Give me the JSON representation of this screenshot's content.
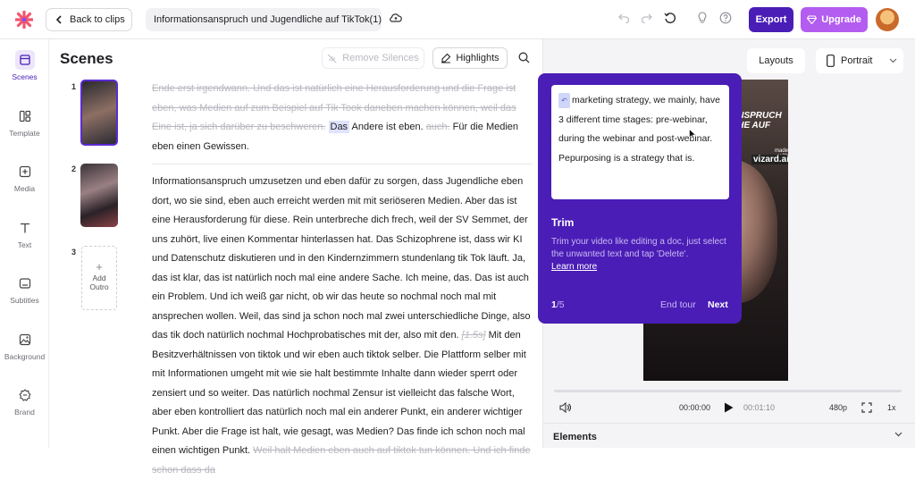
{
  "topbar": {
    "back_label": "Back to clips",
    "project_title": "Informationsanspruch und Jugendliche auf TikTok(1)",
    "export_label": "Export",
    "upgrade_label": "Upgrade"
  },
  "sidebar": {
    "items": [
      {
        "label": "Scenes",
        "icon": "scenes-icon",
        "active": true
      },
      {
        "label": "Template",
        "icon": "template-icon"
      },
      {
        "label": "Media",
        "icon": "media-icon"
      },
      {
        "label": "Text",
        "icon": "text-icon"
      },
      {
        "label": "Subtitles",
        "icon": "subtitles-icon"
      },
      {
        "label": "Background",
        "icon": "background-icon"
      },
      {
        "label": "Brand",
        "icon": "brand-icon"
      }
    ]
  },
  "scenes": {
    "title": "Scenes",
    "remove_silences_label": "Remove Silences",
    "highlights_label": "Highlights",
    "numbers": [
      "1",
      "2",
      "3"
    ],
    "add_outro_label": "Add Outro"
  },
  "transcript": {
    "seg1_struck": "Ende erst irgendwann. Und das ist natürlich eine Herausforderung und die Frage ist eben, was Medien auf zum Beispiel auf Tik Took daneben machen können, weil das Eine ist, ja sich darüber zu beschweren.",
    "seg1_hl": "Das",
    "seg1_mid": " Andere ist eben. ",
    "seg1_faded": "auch.",
    "seg1_end": " Für die Medien eben einen Gewissen.",
    "seg2_a": "Informationsanspruch umzusetzen und eben dafür zu sorgen, dass Jugendliche eben dort, wo sie sind, eben auch erreicht werden mit mit seriöseren Medien. Aber das ist eine Herausforderung für diese. Rein unterbreche dich frech, weil der SV Semmet, der uns zuhört, live einen Kommentar hinterlassen hat. Das Schizophrene ist, dass wir KI und Datenschutz diskutieren und in den Kindernzimmern stundenlang tik Tok läuft. Ja, das ist klar, das ist natürlich noch mal eine andere Sache. Ich meine, das. Das ist auch ein Problem. Und ich weiß gar nicht, ob wir das heute so nochmal noch mal mit ansprechen wollen. Weil, das sind ja schon noch mal zwei unterschiedliche Dinge, also das tik doch natürlich nochmal Hochprobatisches mit der, also mit den. ",
    "pause": "[1.5s]",
    "seg2_b": " Mit den Besitzverhältnissen von tiktok und wir eben auch tiktok selber. Die Plattform selber mit mit Informationen umgeht mit wie sie halt bestimmte Inhalte dann wieder sperrt oder zensiert und so weiter. Das natürlich nochmal Zensur ist vielleicht das falsche Wort, aber eben kontrolliert das natürlich noch mal ein anderer Punkt, ein anderer wichtiger Punkt. Aber die Frage ist halt, wie gesagt, was Medien? Das finde ich schon noch mal einen wichtigen Punkt. ",
    "seg2_faded": "Weil halt Medien eben auch auf tiktok tun können. Und ich finde schon dass da"
  },
  "preview": {
    "layouts_label": "Layouts",
    "portrait_label": "Portrait",
    "video_caption": "ANSPRUCH\nCHE AUF\nK",
    "made_with": "made with",
    "watermark": "vizard.ai",
    "time_current": "00:00:00",
    "time_total": "00:01:10",
    "quality": "480p",
    "speed": "1x",
    "elements_label": "Elements"
  },
  "tour": {
    "card_text": "marketing strategy, we mainly, have 3 different time stages: pre-webinar, during the webinar and post-webinar. Pepurposing is a strategy that is.",
    "title": "Trim",
    "description": "Trim your video like editing a doc, just select the unwanted text and tap 'Delete'.",
    "learn_more": "Learn more",
    "step_current": "1",
    "step_total": "/5",
    "end_tour_label": "End tour",
    "next_label": "Next"
  }
}
